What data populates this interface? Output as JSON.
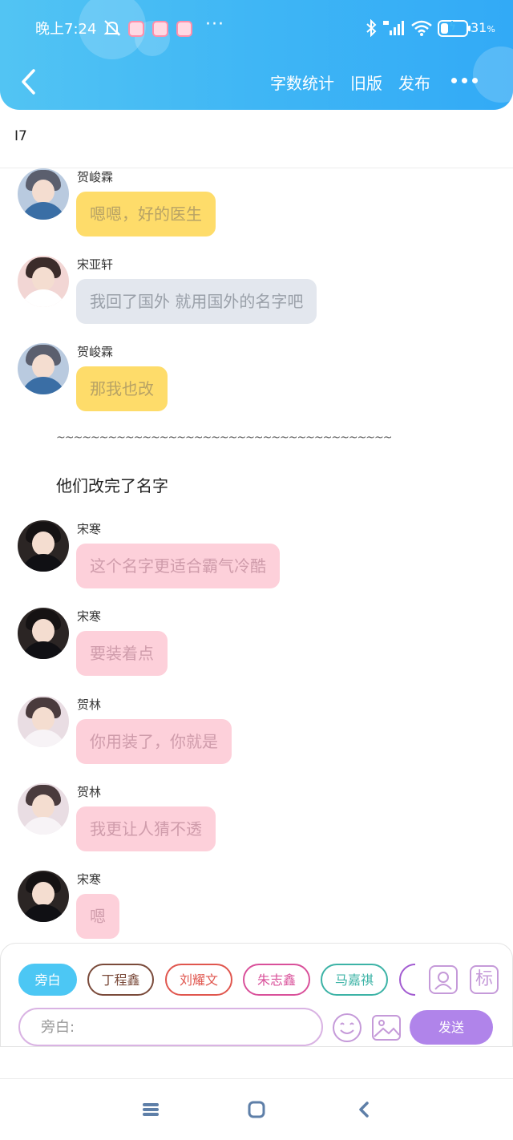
{
  "status_bar": {
    "time": "晚上7:24",
    "overflow_dots": "···",
    "battery_percent": 31,
    "battery_label": "31",
    "battery_unit": "%",
    "icons": [
      "mute-icon",
      "app-notification-icon",
      "bluetooth-icon",
      "hd-signal-icon",
      "wifi-icon",
      "battery-icon"
    ]
  },
  "nav": {
    "back_icon": "chevron-left-icon",
    "word_count_label": "字数统计",
    "old_version_label": "旧版",
    "publish_label": "发布",
    "more_icon": "more-dots-icon"
  },
  "title": "I7",
  "messages": [
    {
      "name": "贺峻霖",
      "text": "嗯嗯，好的医生",
      "style": "yellow"
    },
    {
      "name": "宋亚轩",
      "text": "我回了国外 就用国外的名字吧",
      "style": "gray"
    },
    {
      "name": "贺峻霖",
      "text": "那我也改",
      "style": "yellow"
    }
  ],
  "narration": {
    "divider": "~~~~~~~~~~~~~~~~~~~~~~~~~~~~~~~~~~~~~~~",
    "text": "他们改完了名字"
  },
  "messages2": [
    {
      "name": "宋寒",
      "text": "这个名字更适合霸气冷酷",
      "style": "pink"
    },
    {
      "name": "宋寒",
      "text": "要装着点",
      "style": "pink"
    },
    {
      "name": "贺林",
      "text": "你用装了，你就是",
      "style": "pink"
    },
    {
      "name": "贺林",
      "text": "我更让人猜不透",
      "style": "pink"
    },
    {
      "name": "宋寒",
      "text": "嗯",
      "style": "pink"
    }
  ],
  "characters": [
    {
      "label": "旁白",
      "color": "#4cc7f4",
      "active": true
    },
    {
      "label": "丁程鑫",
      "color": "#7a4a3a",
      "active": false
    },
    {
      "label": "刘耀文",
      "color": "#e0564e",
      "active": false
    },
    {
      "label": "朱志鑫",
      "color": "#d9509a",
      "active": false
    },
    {
      "label": "马嘉祺",
      "color": "#3cb3a6",
      "active": false
    }
  ],
  "tool_buttons": {
    "character_icon": "person-card-icon",
    "tag_label": "标"
  },
  "input": {
    "placeholder": "旁白:",
    "emoji_icon": "emoji-icon",
    "image_icon": "image-icon",
    "send_label": "发送"
  },
  "system_nav": [
    "menu-icon",
    "home-icon",
    "back-icon"
  ],
  "colors": {
    "header": "#3fb6f5",
    "accent_purple": "#b084ea",
    "bubble_yellow": "#fedc6a",
    "bubble_gray": "#e3e7ee",
    "bubble_pink": "#fdd0da"
  }
}
